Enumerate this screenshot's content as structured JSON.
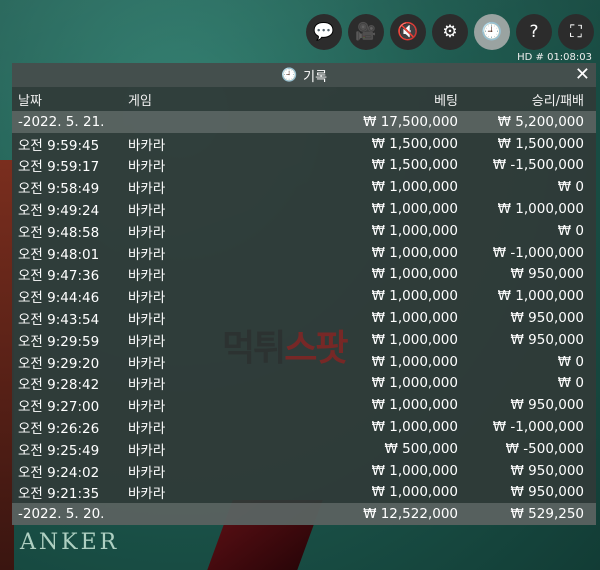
{
  "topbar": {
    "icons": [
      "chat-icon",
      "video-icon",
      "mute-icon",
      "gear-icon",
      "history-icon",
      "help-icon",
      "fullscreen-icon"
    ],
    "hd_text": "HD   # 01:08:03"
  },
  "panel": {
    "title": "기록",
    "columns": {
      "date": "날짜",
      "game": "게임",
      "bet": "베팅",
      "win": "승리/패배"
    },
    "summary_top": {
      "date": "-2022. 5. 21.",
      "bet": "₩ 17,500,000",
      "win": "₩ 5,200,000"
    },
    "rows": [
      {
        "date": "오전 9:59:45",
        "game": "바카라",
        "bet": "₩ 1,500,000",
        "win": "₩ 1,500,000"
      },
      {
        "date": "오전 9:59:17",
        "game": "바카라",
        "bet": "₩ 1,500,000",
        "win": "₩ -1,500,000"
      },
      {
        "date": "오전 9:58:49",
        "game": "바카라",
        "bet": "₩ 1,000,000",
        "win": "₩ 0"
      },
      {
        "date": "오전 9:49:24",
        "game": "바카라",
        "bet": "₩ 1,000,000",
        "win": "₩ 1,000,000"
      },
      {
        "date": "오전 9:48:58",
        "game": "바카라",
        "bet": "₩ 1,000,000",
        "win": "₩ 0"
      },
      {
        "date": "오전 9:48:01",
        "game": "바카라",
        "bet": "₩ 1,000,000",
        "win": "₩ -1,000,000"
      },
      {
        "date": "오전 9:47:36",
        "game": "바카라",
        "bet": "₩ 1,000,000",
        "win": "₩ 950,000"
      },
      {
        "date": "오전 9:44:46",
        "game": "바카라",
        "bet": "₩ 1,000,000",
        "win": "₩ 1,000,000"
      },
      {
        "date": "오전 9:43:54",
        "game": "바카라",
        "bet": "₩ 1,000,000",
        "win": "₩ 950,000"
      },
      {
        "date": "오전 9:29:59",
        "game": "바카라",
        "bet": "₩ 1,000,000",
        "win": "₩ 950,000"
      },
      {
        "date": "오전 9:29:20",
        "game": "바카라",
        "bet": "₩ 1,000,000",
        "win": "₩ 0"
      },
      {
        "date": "오전 9:28:42",
        "game": "바카라",
        "bet": "₩ 1,000,000",
        "win": "₩ 0"
      },
      {
        "date": "오전 9:27:00",
        "game": "바카라",
        "bet": "₩ 1,000,000",
        "win": "₩ 950,000"
      },
      {
        "date": "오전 9:26:26",
        "game": "바카라",
        "bet": "₩ 1,000,000",
        "win": "₩ -1,000,000"
      },
      {
        "date": "오전 9:25:49",
        "game": "바카라",
        "bet": "₩ 500,000",
        "win": "₩ -500,000"
      },
      {
        "date": "오전 9:24:02",
        "game": "바카라",
        "bet": "₩ 1,000,000",
        "win": "₩ 950,000"
      },
      {
        "date": "오전 9:21:35",
        "game": "바카라",
        "bet": "₩ 1,000,000",
        "win": "₩ 950,000"
      }
    ],
    "summary_bottom": {
      "date": "-2022. 5. 20.",
      "bet": "₩ 12,522,000",
      "win": "₩ 529,250"
    }
  },
  "watermark": {
    "part1": "먹튀",
    "part2": "스팟"
  },
  "background": {
    "banker_text": "ANKER"
  }
}
